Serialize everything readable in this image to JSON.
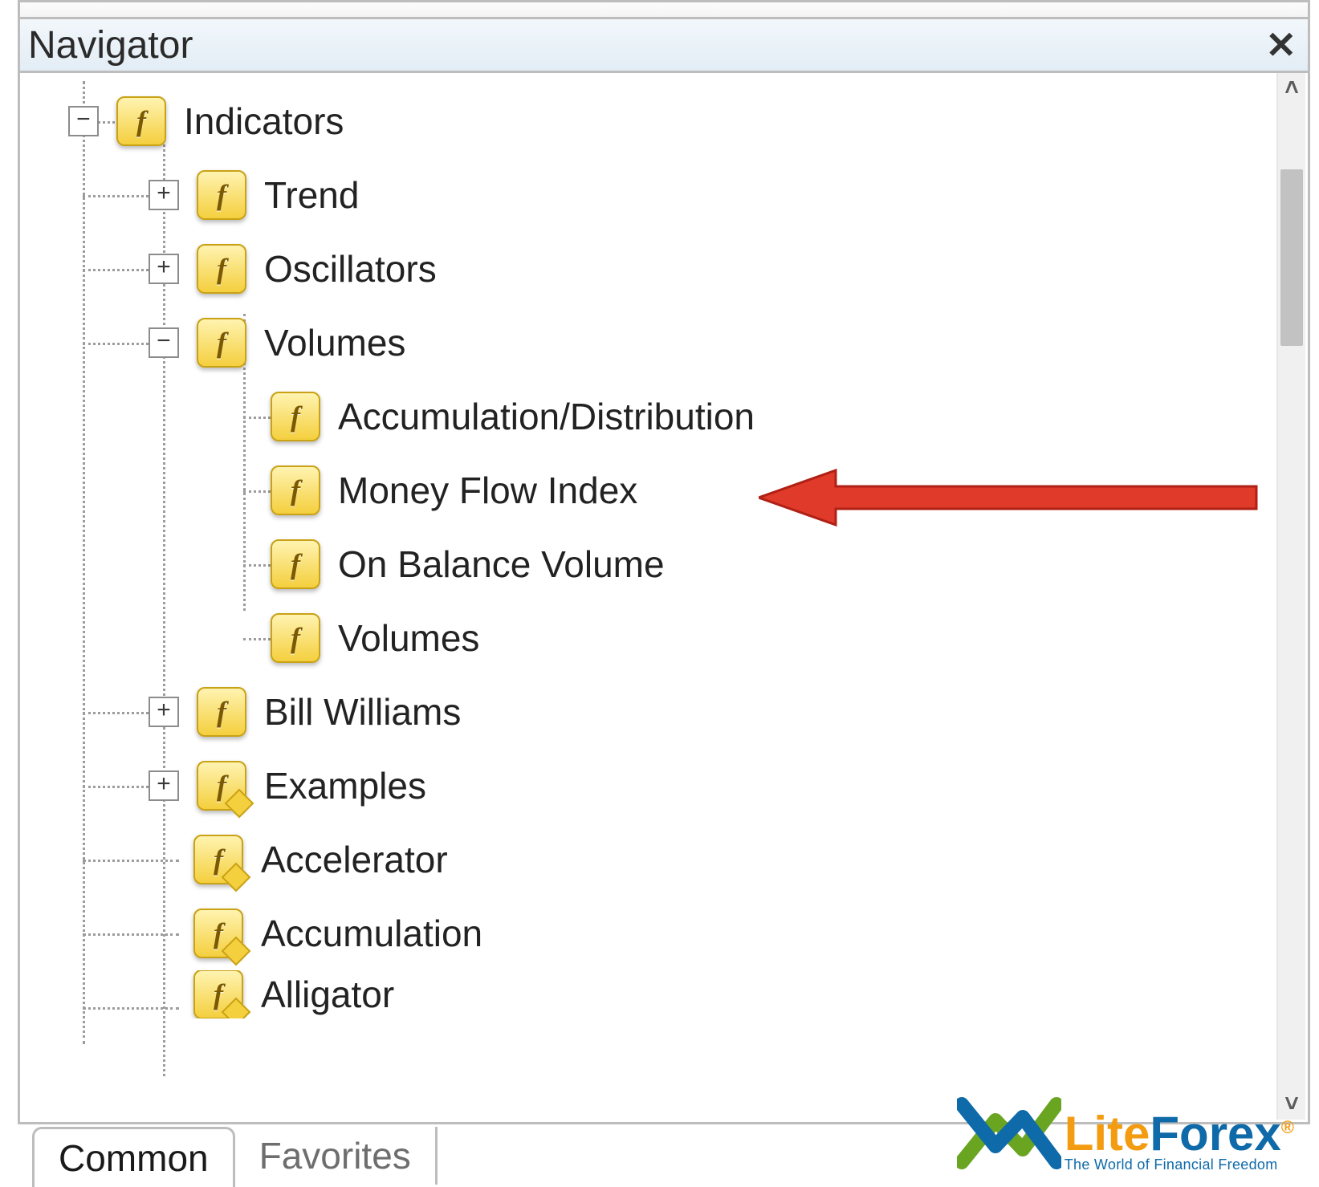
{
  "panel": {
    "title": "Navigator",
    "close_glyph": "✕"
  },
  "tree": {
    "root": {
      "label": "Indicators",
      "expanded": true
    },
    "level1": [
      {
        "label": "Trend",
        "expandable": true,
        "expanded": false,
        "diamond": false
      },
      {
        "label": "Oscillators",
        "expandable": true,
        "expanded": false,
        "diamond": false
      },
      {
        "label": "Volumes",
        "expandable": true,
        "expanded": true,
        "diamond": false
      },
      {
        "label": "Bill Williams",
        "expandable": true,
        "expanded": false,
        "diamond": false
      },
      {
        "label": "Examples",
        "expandable": true,
        "expanded": false,
        "diamond": true
      },
      {
        "label": "Accelerator",
        "expandable": false,
        "expanded": false,
        "diamond": true
      },
      {
        "label": "Accumulation",
        "expandable": false,
        "expanded": false,
        "diamond": true
      },
      {
        "label": "Alligator",
        "expandable": false,
        "expanded": false,
        "diamond": true
      }
    ],
    "volumes_children": [
      {
        "label": "Accumulation/Distribution"
      },
      {
        "label": "Money Flow Index"
      },
      {
        "label": "On Balance Volume"
      },
      {
        "label": "Volumes"
      }
    ]
  },
  "tabs": {
    "active": "Common",
    "inactive": "Favorites"
  },
  "logo": {
    "prefix": "Lite",
    "suffix": "Forex",
    "reg": "®",
    "tagline": "The World of Financial Freedom"
  },
  "scroll": {
    "up_glyph": "˄",
    "down_glyph": "˅"
  },
  "expander": {
    "plus": "+",
    "minus": "−"
  },
  "icons": {
    "f_letter": "f"
  }
}
